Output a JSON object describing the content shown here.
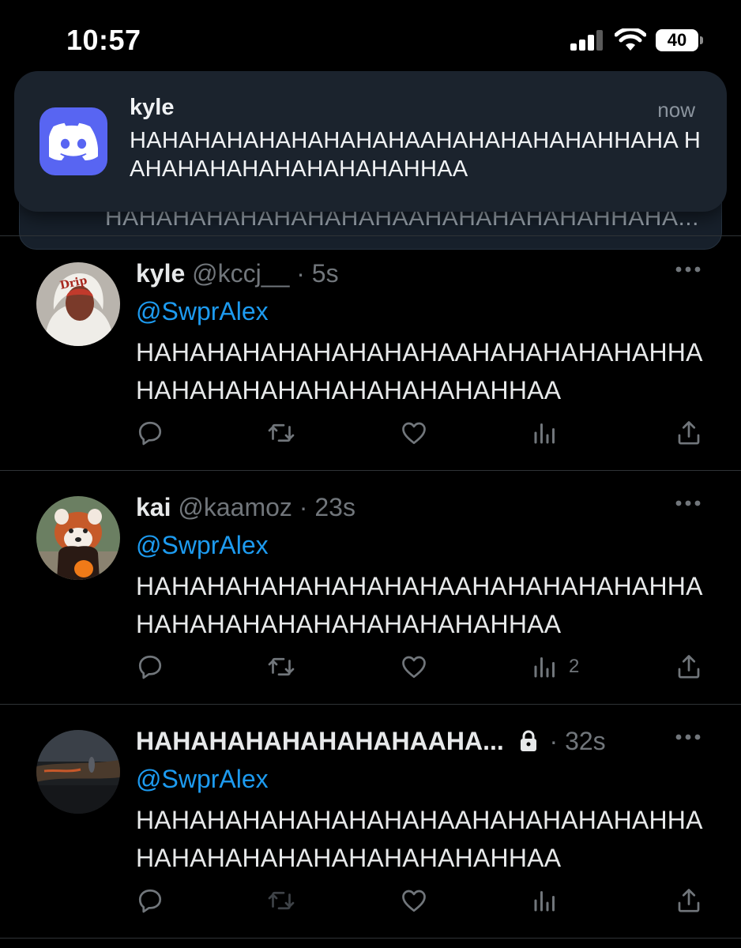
{
  "status_bar": {
    "time": "10:57",
    "battery": "40"
  },
  "notification": {
    "app": "discord",
    "sender": "kyle",
    "time": "now",
    "message": "HAHAHAHAHAHAHAHAHAAHAHAHAHAHAHHAHA HAHAHAHAHAHAHAHAHAHHAA",
    "stacked_preview": "HAHAHAHAHAHAHAHAHAAHAHAHAHAHAHHAHA..."
  },
  "tweets": [
    {
      "name": "kyle",
      "handle": "@kccj__",
      "separator": "·",
      "time": "5s",
      "mention": "@SwprAlex",
      "text": "HAHAHAHAHAHAHAHAHAAHAHAHAHAHAHHA HAHAHAHAHAHAHAHAHAHAHHAA",
      "views": ""
    },
    {
      "name": "kai",
      "handle": "@kaamoz",
      "separator": "·",
      "time": "23s",
      "mention": "@SwprAlex",
      "text": "HAHAHAHAHAHAHAHAHAAHAHAHAHAHAHHA HAHAHAHAHAHAHAHAHAHAHHAA",
      "views": "2"
    },
    {
      "name": "HAHAHAHAHAHAHAHAAHA...",
      "handle": "",
      "separator": "·",
      "time": "32s",
      "mention": "@SwprAlex",
      "text": "HAHAHAHAHAHAHAHAHAAHAHAHAHAHAHHA HAHAHAHAHAHAHAHAHAHAHHAA",
      "views": ""
    }
  ],
  "colors": {
    "background": "#000000",
    "link": "#1d9bf0",
    "secondary_text": "#71767b",
    "discord": "#5865f2"
  }
}
